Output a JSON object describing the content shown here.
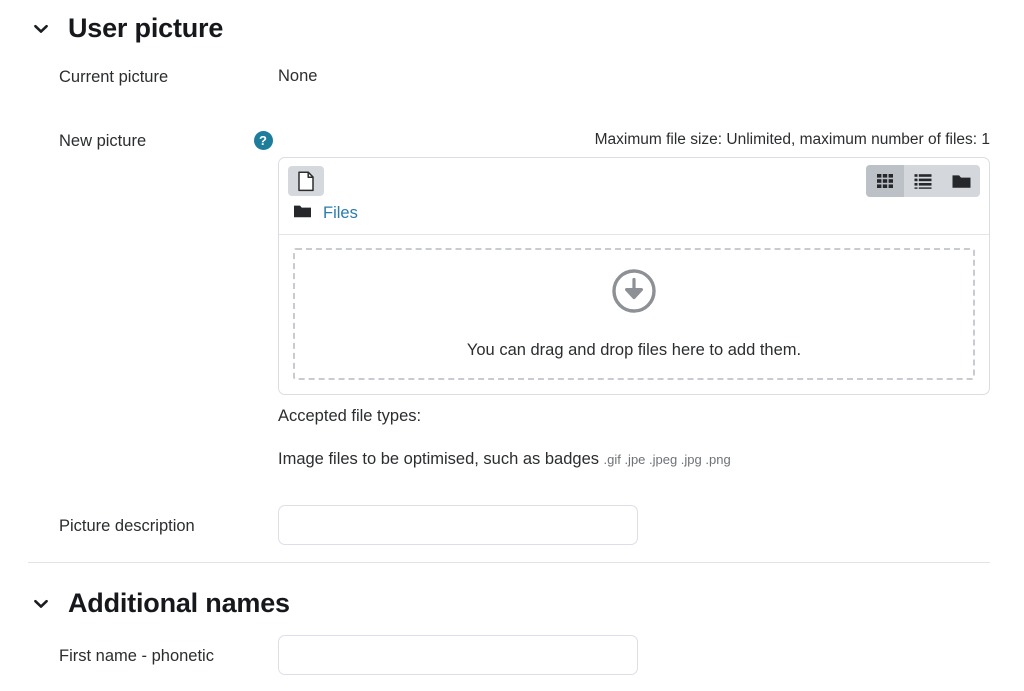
{
  "sections": [
    {
      "id": "user-picture",
      "title": "User picture",
      "chevron": "chevron-down-icon",
      "expanded": true
    },
    {
      "id": "additional-names",
      "title": "Additional names",
      "chevron": "chevron-down-icon",
      "expanded": true
    }
  ],
  "user_picture": {
    "current_picture": {
      "label": "Current picture",
      "value": "None"
    },
    "new_picture": {
      "label": "New picture",
      "help_icon": "help-circle-icon",
      "help_glyph": "?",
      "max_size_note": "Maximum file size: Unlimited, maximum number of files: 1",
      "filepicker": {
        "add_file_button": "add-file-icon",
        "view_buttons": [
          {
            "name": "view-grid",
            "icon": "grid-view-icon",
            "active": true
          },
          {
            "name": "view-list",
            "icon": "list-view-icon",
            "active": false
          },
          {
            "name": "view-tree",
            "icon": "folder-tree-icon",
            "active": false
          }
        ],
        "breadcrumb": {
          "icon": "folder-icon",
          "label": "Files"
        },
        "dropzone": {
          "icon": "download-arrow-icon",
          "text": "You can drag and drop files here to add them."
        }
      },
      "accepted_file_types_label": "Accepted file types:",
      "accepted_file_types_desc": "Image files to be optimised, such as badges",
      "accepted_file_extensions": ".gif .jpe .jpeg .jpg .png"
    },
    "picture_description": {
      "label": "Picture description",
      "value": "",
      "placeholder": ""
    }
  },
  "additional_names": {
    "first_name_phonetic": {
      "label": "First name - phonetic",
      "value": "",
      "placeholder": ""
    }
  },
  "colors": {
    "link": "#2c7cab",
    "help_badge": "#1f7d9c",
    "text": "#2b2d2f",
    "border": "#dcdeea"
  }
}
